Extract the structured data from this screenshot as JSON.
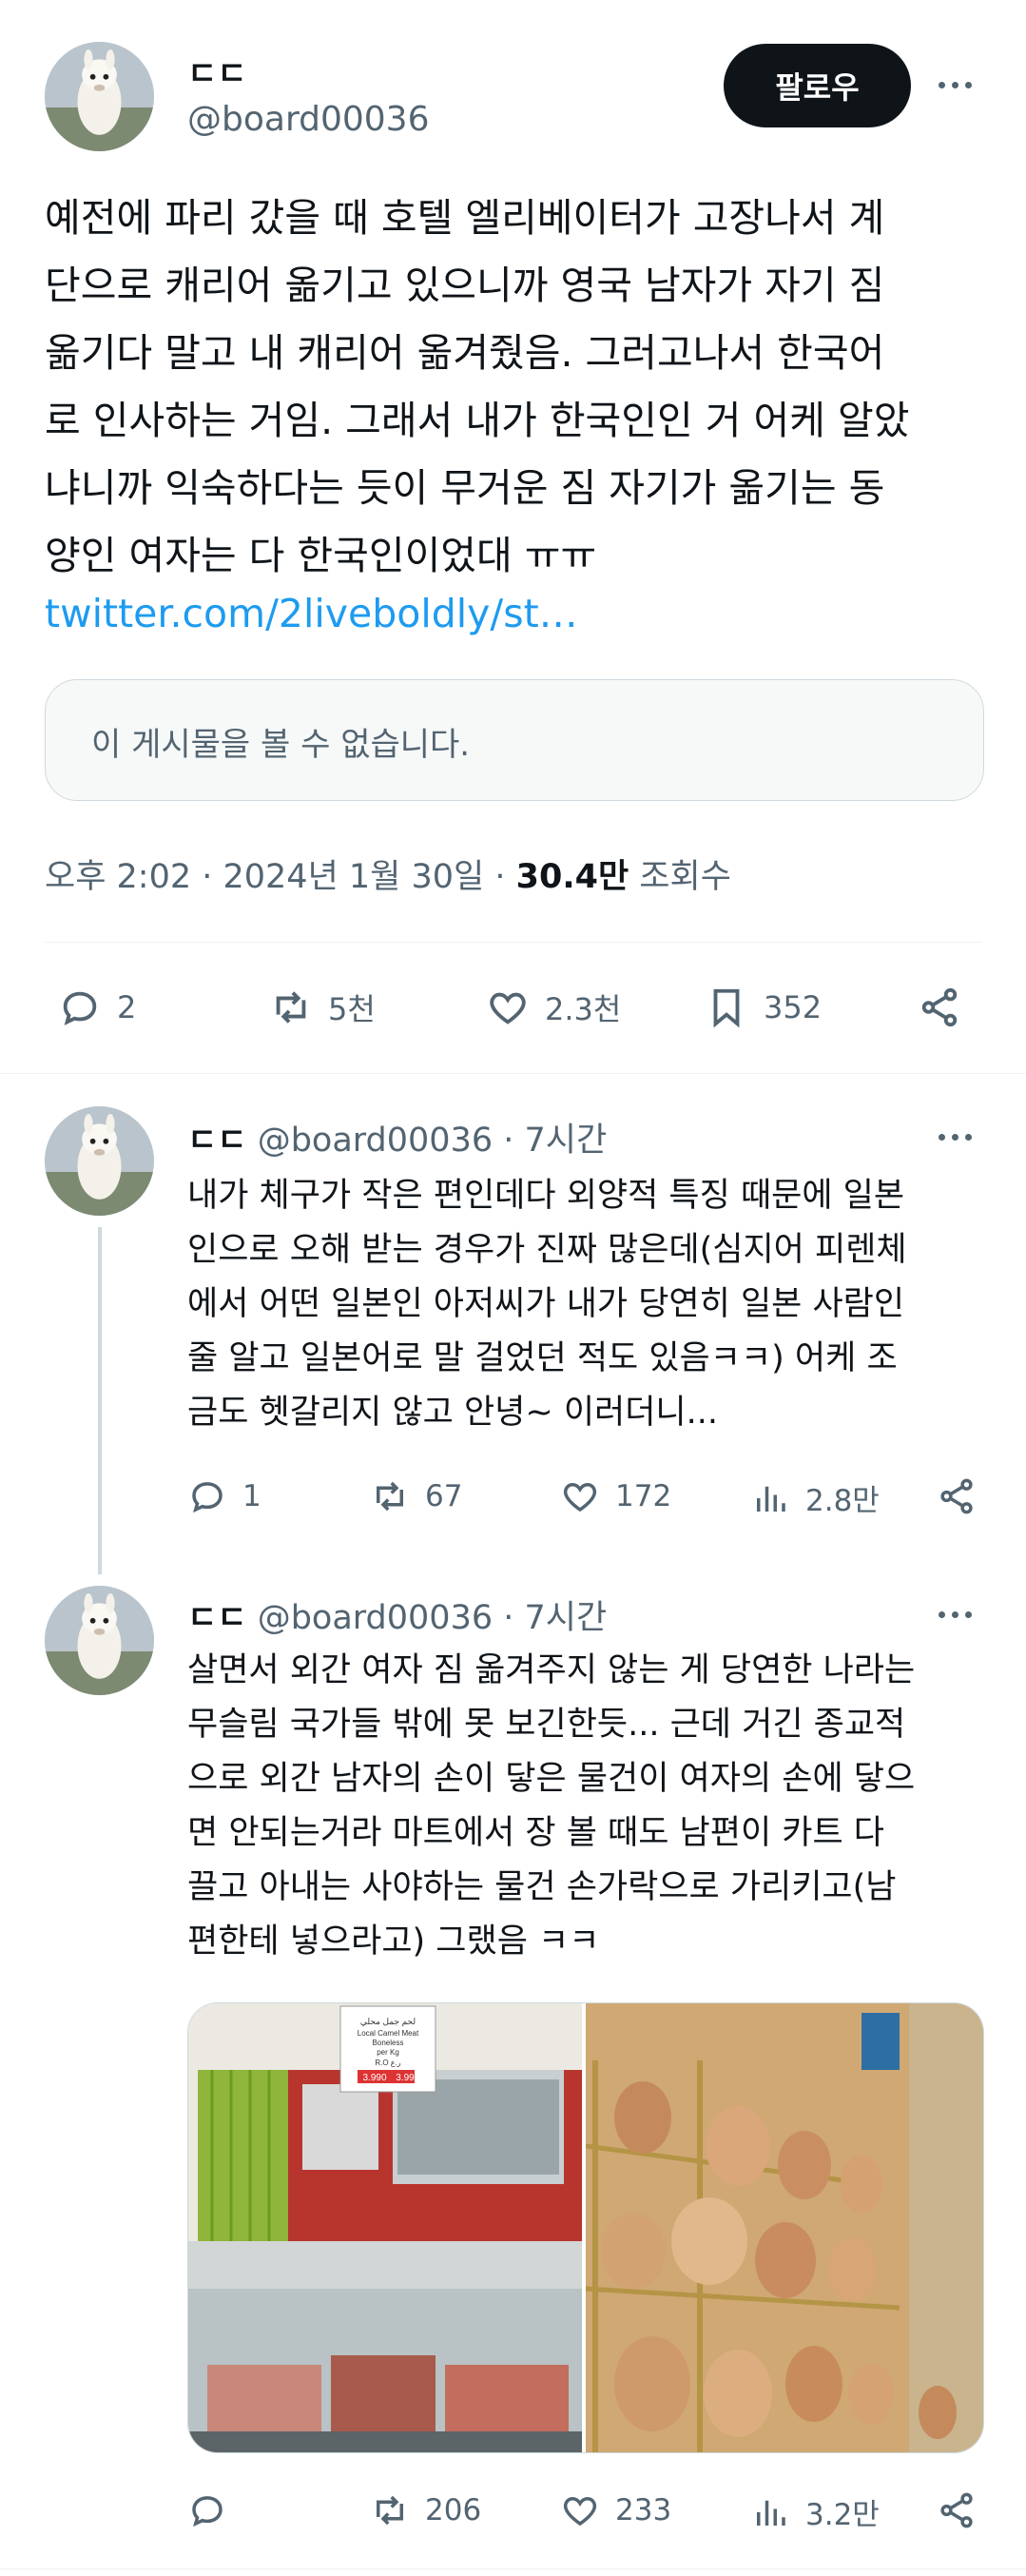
{
  "tweet": {
    "author_name": "ㄷㄷ",
    "author_handle": "@board00036",
    "follow_label": "팔로우",
    "text": "예전에 파리 갔을 때 호텔 엘리베이터가 고장나서 계\n단으로 캐리어 옮기고 있으니까 영국 남자가 자기 짐\n옮기다 말고 내 캐리어 옮겨줬음. 그러고나서 한국어\n로 인사하는 거임. 그래서 내가 한국인인 거 어케 알았\n냐니까 익숙하다는 듯이 무거운 짐 자기가 옮기는 동\n양인 여자는 다 한국인이었대 ㅠㅠ",
    "link": "twitter.com/2liveboldly/st…",
    "quote_unavailable": "이 게시물을 볼 수 없습니다.",
    "time": "오후 2:02 · 2024년 1월 30일 · ",
    "views_count": "30.4만",
    "views_label": " 조회수",
    "stats": {
      "replies": "2",
      "retweets": "5천",
      "likes": "2.3천",
      "bookmarks": "352"
    }
  },
  "replies": [
    {
      "author_name": "ㄷㄷ",
      "author_handle": "@board00036",
      "time": " · 7시간",
      "text": "내가 체구가 작은 편인데다 외양적 특징 때문에 일본\n인으로 오해 받는 경우가 진짜 많은데(심지어 피렌체\n에서 어떤 일본인 아저씨가 내가 당연히 일본 사람인\n줄 알고 일본어로 말 걸었던 적도 있음ㅋㅋ) 어케 조\n금도 헷갈리지 않고 안녕~ 이러더니...",
      "stats": {
        "replies": "1",
        "retweets": "67",
        "likes": "172",
        "views": "2.8만"
      }
    },
    {
      "author_name": "ㄷㄷ",
      "author_handle": "@board00036",
      "time": " · 7시간",
      "text": "살면서 외간 여자 짐 옮겨주지 않는 게 당연한 나라는\n무슬림 국가들 밖에 못 보긴한듯... 근데 거긴 종교적\n으로 외간 남자의 손이 닿은 물건이 여자의 손에 닿으\n면 안되는거라 마트에서 장 볼 때도 남편이 카트 다\n끌고 아내는 사야하는 물건 손가락으로 가리키고(남\n편한테 넣으라고) 그랬음 ㅋㅋ",
      "stats": {
        "replies": "",
        "retweets": "206",
        "likes": "233",
        "views": "3.2만"
      },
      "image_price_sign": [
        "لحم جمل محلي",
        "Local Camel Meat",
        "Boneless",
        "per Kg",
        "R.O  ر.ع",
        "3.990 ",
        "3.99"
      ]
    }
  ],
  "colors": {
    "accent": "#1d9bf0",
    "text": "#0f1419",
    "muted": "#536471",
    "border": "#eff3f4"
  }
}
